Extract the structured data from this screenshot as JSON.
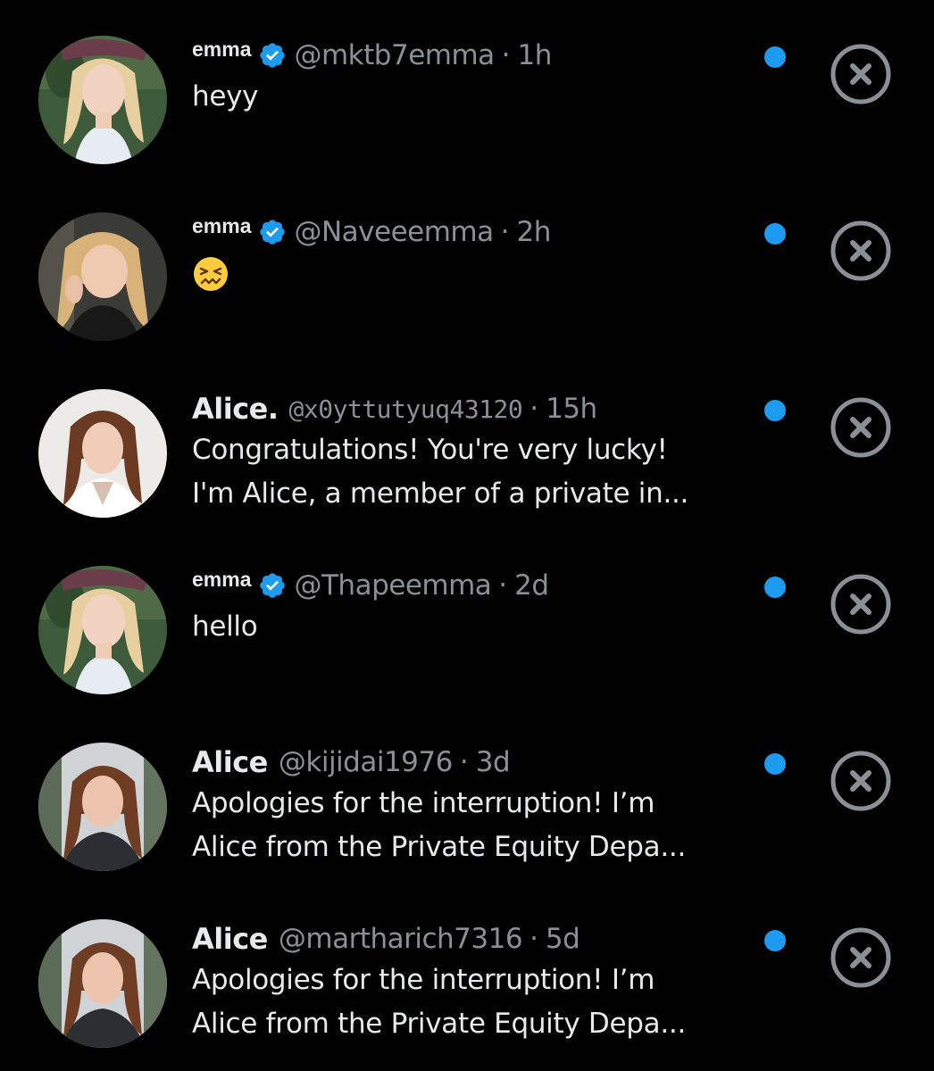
{
  "colors": {
    "background": "#000000",
    "primary_text": "#e7e9ea",
    "secondary_text": "#8b9096",
    "verified_blue": "#1d9bf0",
    "unread_dot": "#1d9bf0",
    "dismiss_icon": "#8b9096"
  },
  "requests": [
    {
      "name": "emma",
      "verified": true,
      "handle": "@mktb7emma",
      "separator": "·",
      "time": "1h",
      "preview_lines": [
        "heyy"
      ],
      "unread": true,
      "icons": [
        "avatar",
        "verified-badge-icon",
        "unread-dot",
        "close-circle-icon"
      ]
    },
    {
      "name": "emma",
      "verified": true,
      "handle": "@Naveeemma",
      "separator": "·",
      "time": "2h",
      "preview_emoji": "confounded-face-emoji",
      "unread": true,
      "icons": [
        "avatar",
        "verified-badge-icon",
        "confounded-face-emoji",
        "unread-dot",
        "close-circle-icon"
      ]
    },
    {
      "name": "Alice.",
      "verified": false,
      "handle": "@x0yttutyuq43120",
      "separator": "·",
      "time": "15h",
      "preview_lines": [
        "Congratulations! You're very lucky!",
        "I'm Alice, a member of a private in..."
      ],
      "unread": true,
      "icons": [
        "avatar",
        "unread-dot",
        "close-circle-icon"
      ]
    },
    {
      "name": "emma",
      "verified": true,
      "handle": "@Thapeemma",
      "separator": "·",
      "time": "2d",
      "preview_lines": [
        "hello"
      ],
      "unread": true,
      "icons": [
        "avatar",
        "verified-badge-icon",
        "unread-dot",
        "close-circle-icon"
      ]
    },
    {
      "name": "Alice",
      "verified": false,
      "handle": "@kijidai1976",
      "separator": "·",
      "time": "3d",
      "preview_lines": [
        "Apologies for the interruption! I’m",
        "Alice from the Private Equity Depa..."
      ],
      "unread": true,
      "icons": [
        "avatar",
        "unread-dot",
        "close-circle-icon"
      ]
    },
    {
      "name": "Alice",
      "verified": false,
      "handle": "@martharich7316",
      "separator": "·",
      "time": "5d",
      "preview_lines": [
        "Apologies for the interruption! I’m",
        "Alice from the Private Equity Depa..."
      ],
      "unread": true,
      "icons": [
        "avatar",
        "unread-dot",
        "close-circle-icon"
      ]
    }
  ]
}
